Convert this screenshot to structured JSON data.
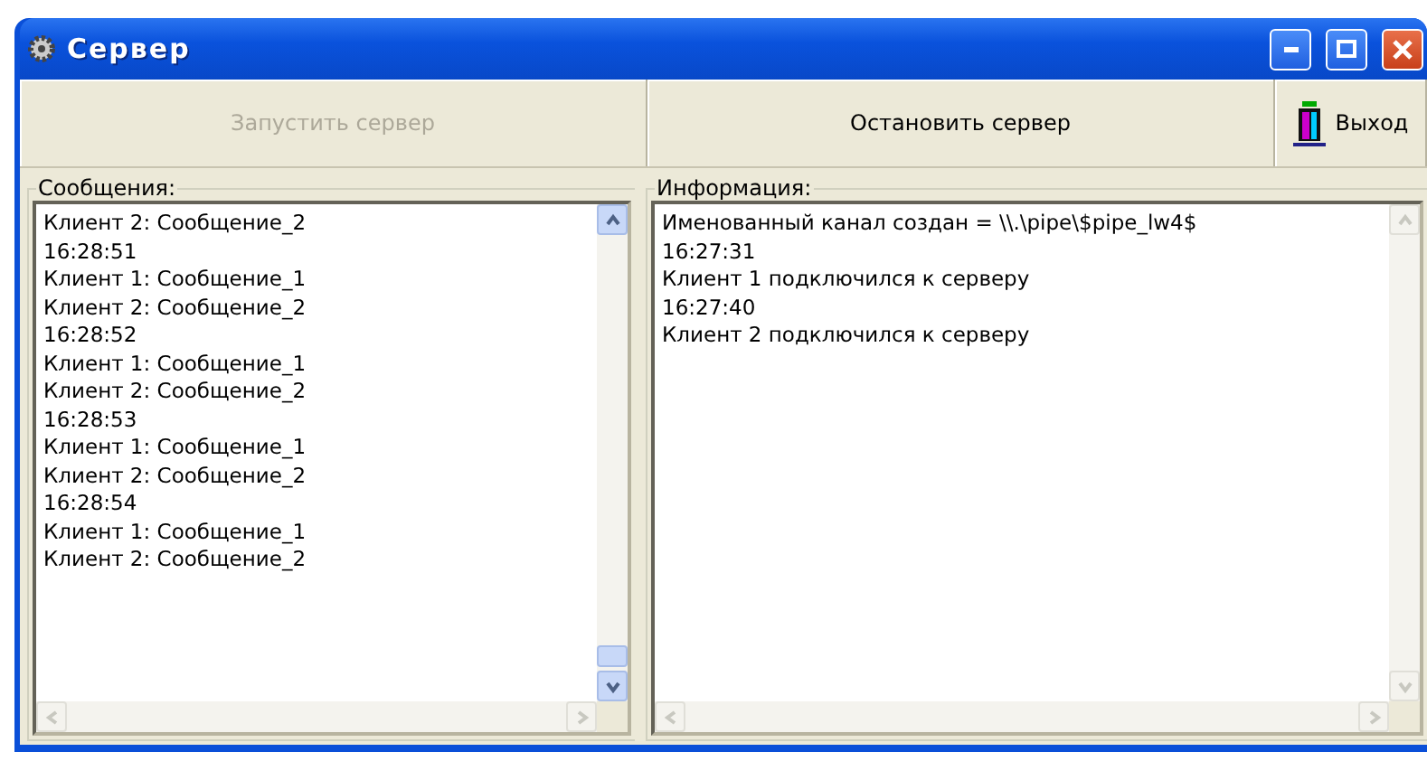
{
  "window": {
    "title": "Сервер"
  },
  "toolbar": [
    {
      "kind": "text",
      "label": "Запустить сервер",
      "disabled": true
    },
    {
      "kind": "text",
      "label": "Остановить сервер",
      "disabled": false
    },
    {
      "kind": "icon",
      "label": "Выход",
      "disabled": false
    }
  ],
  "panels": [
    {
      "title": "Сообщения:",
      "lines": [
        "Клиент 2: Сообщение_2",
        "16:28:51",
        "Клиент 1: Сообщение_1",
        "Клиент 2: Сообщение_2",
        "16:28:52",
        "Клиент 1: Сообщение_1",
        "Клиент 2: Сообщение_2",
        "16:28:53",
        "Клиент 1: Сообщение_1",
        "Клиент 2: Сообщение_2",
        "16:28:54",
        "Клиент 1: Сообщение_1",
        "Клиент 2: Сообщение_2"
      ],
      "scroll_enabled": true
    },
    {
      "title": "Информация:",
      "lines": [
        "Именованный канал создан = \\\\.\\pipe\\$pipe_lw4$",
        "16:27:31",
        "Клиент 1 подключился к серверу",
        "16:27:40",
        "Клиент 2 подключился к серверу"
      ],
      "scroll_enabled": false
    }
  ]
}
